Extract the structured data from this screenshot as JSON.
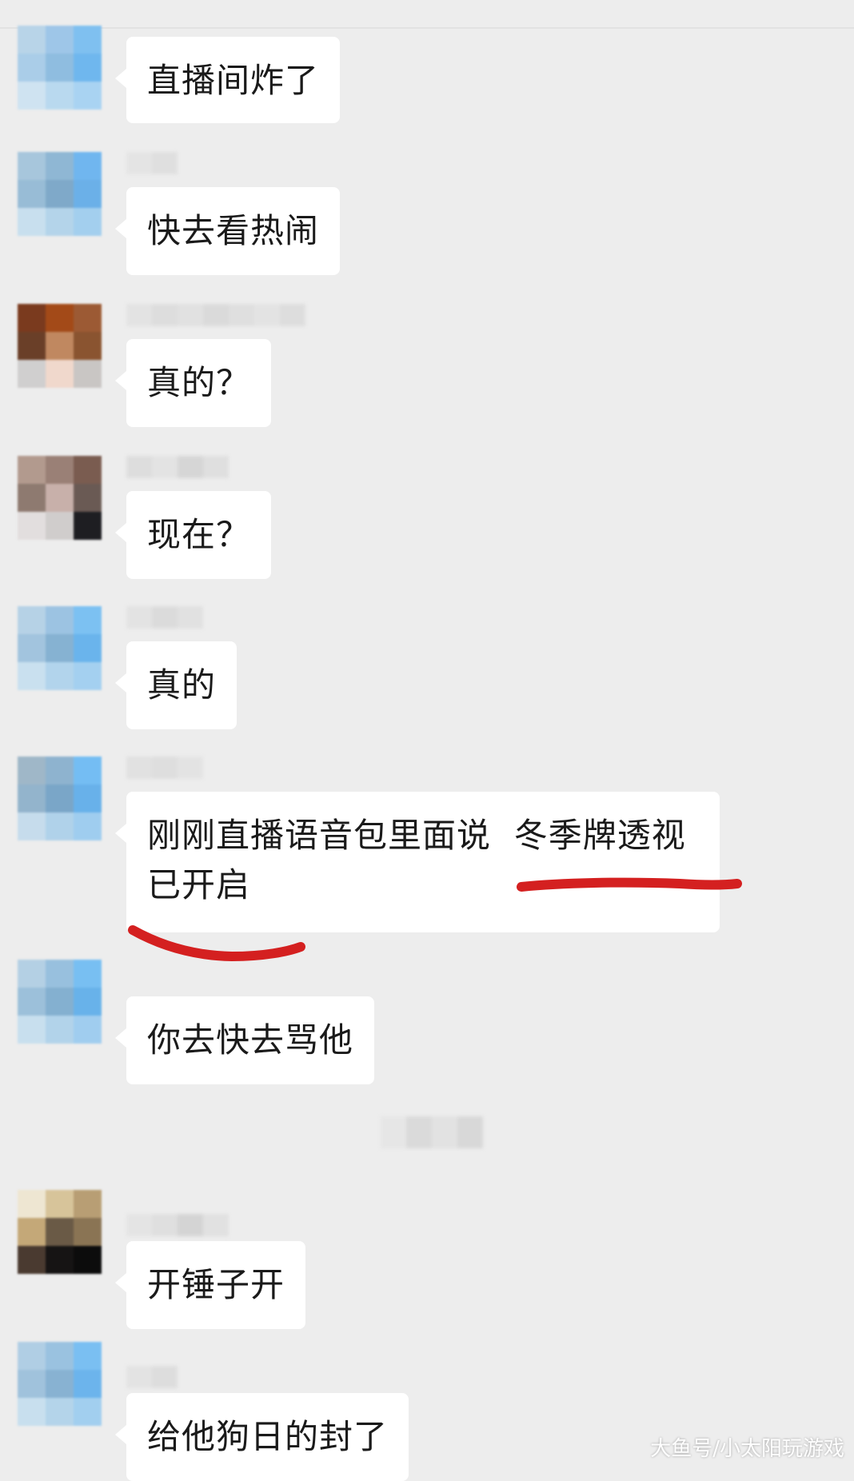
{
  "messages": [
    {
      "text": "直播间炸了"
    },
    {
      "text": "快去看热闹"
    },
    {
      "text": "真的？"
    },
    {
      "text": "现在？"
    },
    {
      "text": "真的"
    },
    {
      "line1": "刚刚直播语音包里面说  冬季牌透视",
      "line2": "已开启"
    },
    {
      "text": "你去快去骂他"
    },
    {
      "text": "开锤子开"
    },
    {
      "text": "给他狗日的封了"
    }
  ],
  "watermark": "大鱼号/小太阳玩游戏",
  "colors": {
    "background": "#ededed",
    "bubble": "#ffffff",
    "text": "#1a1a1a",
    "annotation": "#d42020"
  },
  "icons": {
    "avatar": "avatar-pixelated",
    "underline": "red-marker-underline"
  }
}
